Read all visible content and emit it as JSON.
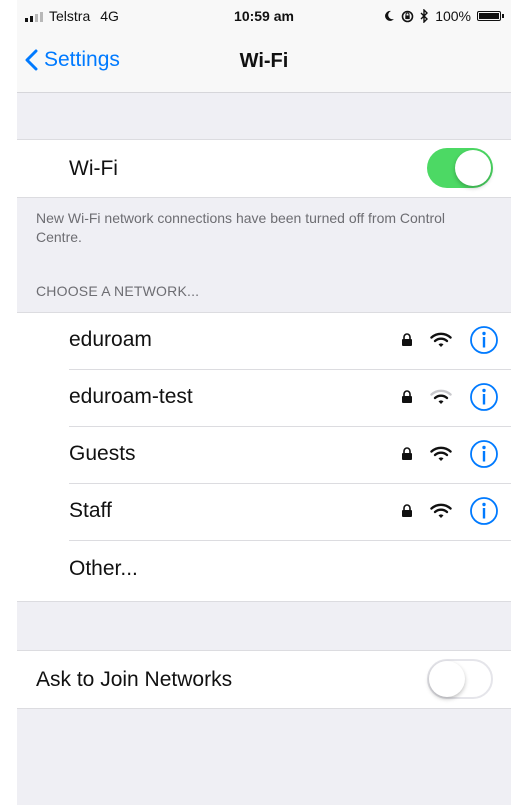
{
  "status_bar": {
    "carrier": "Telstra",
    "network": "4G",
    "time": "10:59 am",
    "battery": "100%",
    "icons": [
      "moon-icon",
      "rotation-lock-icon",
      "bluetooth-icon",
      "battery-icon"
    ]
  },
  "nav": {
    "back_label": "Settings",
    "title": "Wi-Fi"
  },
  "wifi_toggle": {
    "label": "Wi-Fi",
    "on": true
  },
  "footnote": "New Wi-Fi network connections have been turned off from Control Centre.",
  "section_header": "CHOOSE A NETWORK...",
  "networks": [
    {
      "name": "eduroam",
      "locked": true,
      "signal_bars": 3
    },
    {
      "name": "eduroam-test",
      "locked": true,
      "signal_bars": 2
    },
    {
      "name": "Guests",
      "locked": true,
      "signal_bars": 3
    },
    {
      "name": "Staff",
      "locked": true,
      "signal_bars": 3
    }
  ],
  "other_label": "Other...",
  "ask_to_join": {
    "label": "Ask to Join Networks",
    "on": false
  },
  "colors": {
    "accent": "#007aff",
    "toggle_on": "#4cd964",
    "background": "#efeff4"
  }
}
